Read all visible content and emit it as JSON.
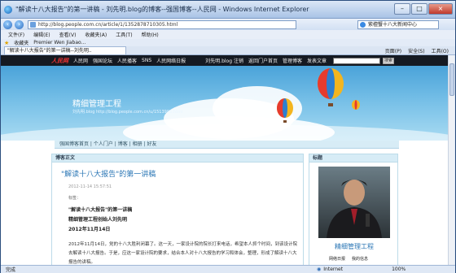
{
  "window": {
    "title": "\"解读十八大报告\"的第一讲稿 - 刘先明.blog的博客--强国博客--人民网 - Windows Internet Explorer",
    "min": "–",
    "max": "□",
    "close": "×"
  },
  "address": {
    "url": "http://blog.people.com.cn/article/1/1352878710305.html",
    "search": "紫檀蟹十八大新闻中心"
  },
  "menu": [
    "文件(F)",
    "编辑(E)",
    "查看(V)",
    "收藏夹(A)",
    "工具(T)",
    "帮助(H)"
  ],
  "favorites": {
    "label": "收藏夹",
    "item": "Premier Wen Jiabao..."
  },
  "tab": {
    "label": "\"解读十八大报告\"的第一讲稿--刘先明.."
  },
  "tools": {
    "page": "页面(P)",
    "safety": "安全(S)",
    "tools": "工具(O)"
  },
  "topnav": {
    "logo": "人民网",
    "links": [
      "人民网",
      "强国论坛",
      "人民播客",
      "SNS",
      "人民网络日报"
    ],
    "right": [
      "刘先明.blog 注销",
      "返回门户首页",
      "管理博客",
      "发表文章"
    ],
    "search_btn": "搜索"
  },
  "banner": {
    "title": "精细管理工程",
    "subtitle": "刘先明.blog http://blog.people.com.cn/u/1513996.html"
  },
  "blognav": {
    "items": [
      "强国博客首页",
      "个人门户",
      "博客",
      "相册",
      "好友"
    ]
  },
  "post": {
    "section": "博客正文",
    "title": "\"解读十八大报告\"的第一讲稿",
    "date": "2012-11-14 15:57:51",
    "tags": "标签：",
    "line1": "\"解读十八大报告\"的第一讲稿",
    "line2": "精细管理工程创始人刘先明",
    "line3": "2012年11月14日",
    "body": "2012年11月14日，党的十八大胜利闭幕了。这一天，一家设计院的院长打来电话，希望本人抓个时间，到该设计院去解读十八大报告。于是，应这一家设计院的要求，结合本人对十八大报告的学习和体会，整理，形成了解读十八大报告的讲稿。"
  },
  "sidebar": {
    "title": "标题",
    "name": "精细管理工程",
    "icon1": "网络日报",
    "icon2": "我的信息"
  },
  "status": {
    "text": "完成",
    "zone": "Internet",
    "zoom": "100%"
  },
  "colors": {
    "accent": "#2a76b5",
    "topnav": "#151a22"
  }
}
